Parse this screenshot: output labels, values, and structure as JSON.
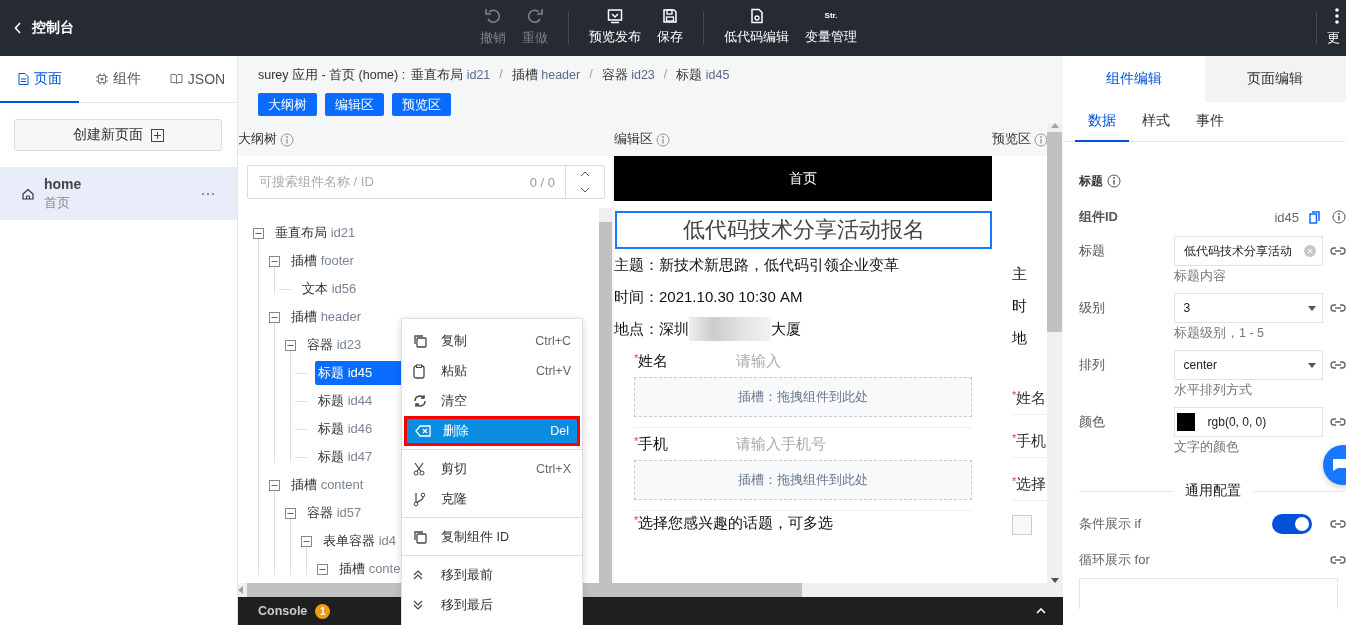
{
  "topbar": {
    "back_label": "控制台",
    "action_groups": [
      [
        {
          "label": "撤销",
          "disabled": true
        },
        {
          "label": "重做",
          "disabled": true
        }
      ],
      [
        {
          "label": "预览发布",
          "disabled": false
        },
        {
          "label": "保存",
          "disabled": false
        }
      ],
      [
        {
          "label": "低代码编辑",
          "disabled": false
        },
        {
          "label": "变量管理",
          "disabled": false,
          "icon_text": "Str."
        }
      ],
      [
        {
          "label": "更",
          "disabled": false
        }
      ]
    ]
  },
  "sidebar": {
    "tabs": [
      {
        "label": "页面",
        "selected": true
      },
      {
        "label": "组件",
        "selected": false
      },
      {
        "label": "JSON",
        "selected": false
      }
    ],
    "create_button": "创建新页面",
    "pages": [
      {
        "name": "home",
        "title": "首页",
        "selected": true
      }
    ]
  },
  "breadcrumb": {
    "prefix": "surey 应用 - 首页 (home) :",
    "items": [
      {
        "name": "垂直布局",
        "id": "id21"
      },
      {
        "separator": "/",
        "name": "插槽",
        "id": "header"
      },
      {
        "separator": "/",
        "name": "容器",
        "id": "id23"
      },
      {
        "separator": "/",
        "name": "标题",
        "id": "id45"
      }
    ]
  },
  "view_buttons": [
    "大纲树",
    "编辑区",
    "预览区"
  ],
  "outline": {
    "heading": "大纲树",
    "search": {
      "placeholder": "可搜索组件名称 / ID",
      "count": "0 / 0"
    },
    "tree": [
      {
        "name": "垂直布局",
        "id": "id21",
        "expanded": true,
        "selected": false,
        "children": [
          {
            "name": "插槽",
            "id": "footer",
            "expanded": true,
            "selected": false,
            "children": [
              {
                "name": "文本",
                "id": "id56",
                "selected": false
              }
            ]
          },
          {
            "name": "插槽",
            "id": "header",
            "expanded": true,
            "selected": false,
            "children": [
              {
                "name": "容器",
                "id": "id23",
                "expanded": true,
                "selected": false,
                "children": [
                  {
                    "name": "标题",
                    "id": "id45",
                    "selected": true
                  },
                  {
                    "name": "标题",
                    "id": "id44",
                    "selected": false
                  },
                  {
                    "name": "标题",
                    "id": "id46",
                    "selected": false
                  },
                  {
                    "name": "标题",
                    "id": "id47",
                    "selected": false
                  }
                ]
              }
            ]
          },
          {
            "name": "插槽",
            "id": "content",
            "expanded": true,
            "selected": false,
            "children": [
              {
                "name": "容器",
                "id": "id57",
                "expanded": true,
                "selected": false,
                "children": [
                  {
                    "name": "表单容器",
                    "id": "id4",
                    "expanded": true,
                    "selected": false,
                    "children": [
                      {
                        "name": "插槽",
                        "id": "conte",
                        "expanded": true,
                        "selected": false
                      }
                    ]
                  }
                ]
              }
            ]
          }
        ]
      }
    ]
  },
  "editor": {
    "heading": "编辑区",
    "page_title": "首页",
    "title": "低代码技术分享活动报名",
    "title_selected": true,
    "info": [
      {
        "text": "主题：新技术新思路，低代码引领企业变革",
        "redacted": false
      },
      {
        "text": "时间：2021.10.30 10:30 AM",
        "redacted": false
      },
      {
        "text": "地点：深圳",
        "redacted": true,
        "after": "大厦"
      }
    ],
    "form": [
      {
        "label": "姓名",
        "required_mark": "*",
        "placeholder": "请输入",
        "slot_hint": "插槽：拖拽组件到此处"
      },
      {
        "label": "手机",
        "required_mark": "*",
        "placeholder": "请输入手机号",
        "slot_hint": "插槽：拖拽组件到此处"
      },
      {
        "label": "选择您感兴趣的话题，可多选",
        "required_mark": "*"
      }
    ]
  },
  "preview": {
    "heading": "预览区",
    "lines": [
      "主",
      "时",
      "地"
    ],
    "form": [
      {
        "label": "姓名",
        "required_mark": "*"
      },
      {
        "label": "手机",
        "required_mark": "*"
      },
      {
        "label": "选择",
        "required_mark": "*"
      }
    ],
    "checkbox": {
      "checked": false
    }
  },
  "console": {
    "label": "Console",
    "badge": "1"
  },
  "context_menu": {
    "groups": [
      [
        {
          "label": "复制",
          "shortcut": "Ctrl+C",
          "highlighted": false
        },
        {
          "label": "粘贴",
          "shortcut": "Ctrl+V",
          "highlighted": false
        },
        {
          "label": "清空",
          "highlighted": false
        },
        {
          "label": "删除",
          "shortcut": "Del",
          "highlighted": true
        }
      ],
      [
        {
          "label": "剪切",
          "shortcut": "Ctrl+X",
          "highlighted": false
        },
        {
          "label": "克隆",
          "highlighted": false
        }
      ],
      [
        {
          "label": "复制组件 ID",
          "highlighted": false
        }
      ],
      [
        {
          "label": "移到最前",
          "highlighted": false
        },
        {
          "label": "移到最后",
          "highlighted": false
        }
      ]
    ]
  },
  "properties": {
    "tabs": [
      {
        "label": "组件编辑",
        "selected": true
      },
      {
        "label": "页面编辑",
        "selected": false
      }
    ],
    "subtabs": [
      {
        "label": "数据",
        "selected": true
      },
      {
        "label": "样式",
        "selected": false
      },
      {
        "label": "事件",
        "selected": false
      }
    ],
    "section": "标题",
    "component_id": {
      "label": "组件ID",
      "value": "id45"
    },
    "fields": [
      {
        "kind": "text",
        "label": "标题",
        "value": "低代码技术分享活动",
        "hint": "标题内容"
      },
      {
        "kind": "select",
        "label": "级别",
        "value": "3",
        "hint": "标题级别，1 - 5"
      },
      {
        "kind": "select",
        "label": "排列",
        "value": "center",
        "hint": "水平排列方式"
      },
      {
        "kind": "color",
        "label": "颜色",
        "value": "rgb(0, 0, 0)",
        "hint": "文字的颜色"
      }
    ],
    "general": {
      "heading": "通用配置",
      "rows": [
        {
          "kind": "toggle",
          "label": "条件展示 if",
          "on": true
        },
        {
          "kind": "plain",
          "label": "循环展示 for"
        }
      ]
    }
  }
}
